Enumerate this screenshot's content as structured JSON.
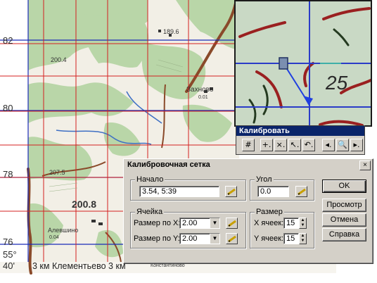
{
  "map": {
    "coords_left": [
      "82",
      "80",
      "78",
      "76"
    ],
    "corner_lat": "55°",
    "corner_lon": "40'",
    "bottom_text": "3 км Клементьево 3 км",
    "labels": {
      "elev_1896": "189.6",
      "elev_2004": "200.4",
      "elev_2008": "200.8",
      "elev_2075": "207.5",
      "village_zakhnovo": "Захново",
      "village_alevshino": "Алевшино",
      "zakhnovo_sub": "0.01",
      "alevshino_sub": "0.04",
      "bottom_small": "Константиново"
    }
  },
  "magnifier": {
    "number": "25"
  },
  "calibrate_toolbar": {
    "title": "Калибровать",
    "buttons": [
      {
        "name": "grid",
        "glyph": "#"
      },
      {
        "name": "add-point",
        "glyph": "+."
      },
      {
        "name": "delete-point",
        "glyph": "×."
      },
      {
        "name": "move-point",
        "glyph": "↖."
      },
      {
        "name": "rotate-point",
        "glyph": "↶."
      },
      {
        "name": "previous",
        "glyph": "◂."
      },
      {
        "name": "zoom",
        "glyph": "🔍"
      },
      {
        "name": "next",
        "glyph": "▸."
      }
    ]
  },
  "dialog": {
    "title": "Калибровочная сетка",
    "close": "×",
    "start": {
      "label": "Начало",
      "value": "3.54, 5:39"
    },
    "angle": {
      "label": "Угол",
      "value": "0.0"
    },
    "cell": {
      "label": "Ячейка",
      "size_x_label": "Размер по X:",
      "size_x_value": "2.00",
      "size_y_label": "Размер по Y:",
      "size_y_value": "2.00"
    },
    "size": {
      "label": "Размер",
      "x_cells_label": "X ячеек:",
      "x_cells_value": "15",
      "y_cells_label": "Y ячеек:",
      "y_cells_value": "15"
    },
    "buttons": {
      "ok": "OK",
      "preview": "Просмотр",
      "cancel": "Отмена",
      "help": "Справка"
    }
  },
  "colors": {
    "forest": "#b9d6a8",
    "field": "#f2efe6",
    "grid_red": "#d42020",
    "grid_blue": "#1a2bb8",
    "road": "#8a4a2a",
    "titlebar": "#0a246a"
  },
  "icons": {
    "pick": "pencil-icon",
    "dropdown": "chevron-down-icon",
    "spinner": "spinner-arrows-icon"
  }
}
